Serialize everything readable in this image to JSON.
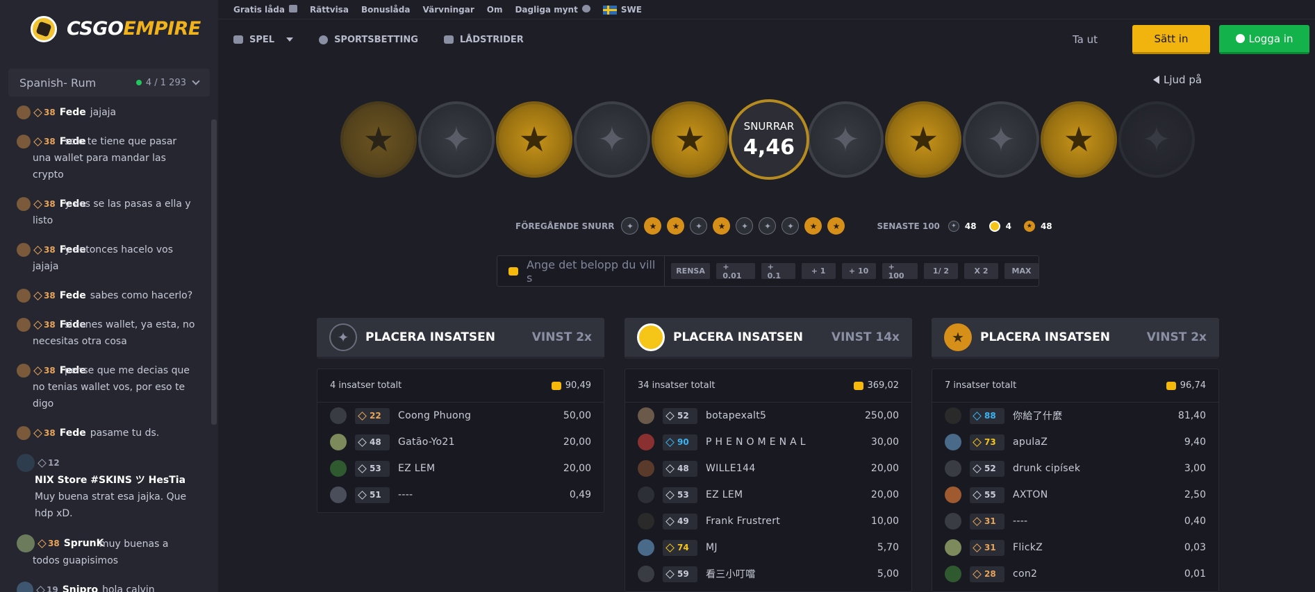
{
  "brand": {
    "part1": "CSGO",
    "part2": "EMPIRE"
  },
  "chat": {
    "room_name": "Spanish- Rum",
    "online": "4 / 1 293",
    "messages": [
      {
        "level": "38",
        "user": "Fede",
        "text": "jajaja"
      },
      {
        "level": "38",
        "user": "Fede",
        "text": "solo te tiene que pasar una wallet para mandar las crypto"
      },
      {
        "level": "38",
        "user": "Fede",
        "text": "y vos se las pasas a ella y listo"
      },
      {
        "level": "38",
        "user": "Fede",
        "text": "y entonces hacelo vos jajaja"
      },
      {
        "level": "38",
        "user": "Fede",
        "text": "sabes como hacerlo?"
      },
      {
        "level": "38",
        "user": "Fede",
        "text": "si tenes wallet, ya esta, no necesitas otra cosa"
      },
      {
        "level": "38",
        "user": "Fede",
        "text": "pense que me decias que no tenias wallet vos, por eso te digo"
      },
      {
        "level": "38",
        "user": "Fede",
        "text": "pasame tu ds."
      },
      {
        "level": "12",
        "user": "NIX Store #SKINS ツ HesTia",
        "text": "Muy buena strat esa jajka. Que hdp xD."
      },
      {
        "level": "38",
        "user": "SprunK",
        "text": "muy buenas a todos guapisimos"
      },
      {
        "level": "19",
        "user": "Snipro",
        "text": "hola calvin"
      }
    ]
  },
  "topbar": {
    "free_case": "Gratis låda",
    "fair": "Rättvisa",
    "bonus": "Bonuslåda",
    "referrals": "Värvningar",
    "about": "Om",
    "daily": "Dagliga mynt",
    "lang": "SWE"
  },
  "nav": {
    "games": "SPEL",
    "sports": "SPORTSBETTING",
    "cases": "LÅDSTRIDER",
    "withdraw": "Ta ut",
    "deposit": "Sätt in",
    "login": "Logga in"
  },
  "sound": "Ljud på",
  "roll": {
    "label": "SNURRAR",
    "value": "4,46"
  },
  "previous": {
    "label": "FÖREGÅENDE SNURR",
    "rolls": [
      "ct",
      "t",
      "t",
      "ct",
      "t",
      "ct",
      "ct",
      "ct",
      "t",
      "t"
    ]
  },
  "last100": {
    "label": "SENASTE 100",
    "ct": "48",
    "bonus": "4",
    "t": "48"
  },
  "bet": {
    "placeholder": "Ange det belopp du vill s",
    "buttons": [
      "RENSA",
      "+ 0.01",
      "+ 0.1",
      "+ 1",
      "+ 10",
      "+ 100",
      "1/ 2",
      "X 2",
      "MAX"
    ]
  },
  "columns": [
    {
      "title": "PLACERA INSATSEN",
      "win": "VINST 2x",
      "kind": "ct",
      "count": "4 insatser totalt",
      "total": "90,49",
      "rows": [
        {
          "lvl": "22",
          "name": "Coong Phuong",
          "amount": "50,00"
        },
        {
          "lvl": "48",
          "name": "Gatão-Yo21",
          "amount": "20,00"
        },
        {
          "lvl": "53",
          "name": "EZ LEM",
          "amount": "20,00"
        },
        {
          "lvl": "51",
          "name": "----",
          "amount": "0,49"
        }
      ]
    },
    {
      "title": "PLACERA INSATSEN",
      "win": "VINST 14x",
      "kind": "bonus",
      "count": "34 insatser totalt",
      "total": "369,02",
      "rows": [
        {
          "lvl": "52",
          "name": "botapexalt5",
          "amount": "250,00"
        },
        {
          "lvl": "90",
          "name": "P H E N O M E N A L",
          "amount": "30,00"
        },
        {
          "lvl": "48",
          "name": "WILLE144",
          "amount": "20,00"
        },
        {
          "lvl": "53",
          "name": "EZ LEM",
          "amount": "20,00"
        },
        {
          "lvl": "49",
          "name": "Frank Frustrert",
          "amount": "10,00"
        },
        {
          "lvl": "74",
          "name": "MJ",
          "amount": "5,70"
        },
        {
          "lvl": "59",
          "name": "看三小叮噹",
          "amount": "5,00"
        }
      ]
    },
    {
      "title": "PLACERA INSATSEN",
      "win": "VINST 2x",
      "kind": "t",
      "count": "7 insatser totalt",
      "total": "96,74",
      "rows": [
        {
          "lvl": "88",
          "name": "你給了什麼",
          "amount": "81,40"
        },
        {
          "lvl": "73",
          "name": "apulaZ",
          "amount": "9,40"
        },
        {
          "lvl": "52",
          "name": "drunk cipísek",
          "amount": "3,00"
        },
        {
          "lvl": "55",
          "name": "AXTON",
          "amount": "2,50"
        },
        {
          "lvl": "31",
          "name": "----",
          "amount": "0,40"
        },
        {
          "lvl": "31",
          "name": "FlickZ",
          "amount": "0,03"
        },
        {
          "lvl": "28",
          "name": "con2",
          "amount": "0,01"
        }
      ]
    }
  ],
  "colors": {
    "gold": "#f1b30e",
    "green": "#13b24a",
    "bg": "#1d1e26"
  }
}
